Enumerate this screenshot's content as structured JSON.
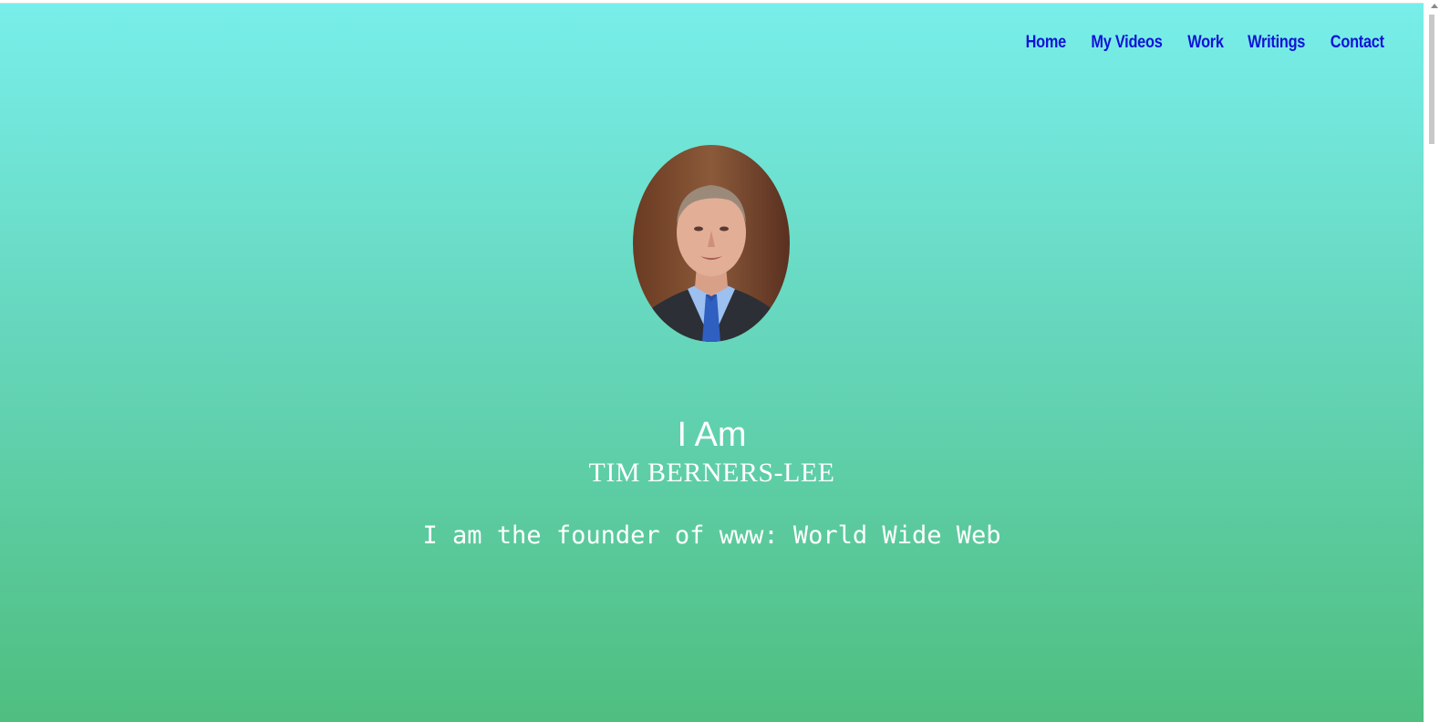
{
  "nav": {
    "items": [
      {
        "label": "Home"
      },
      {
        "label": "My Videos"
      },
      {
        "label": "Work"
      },
      {
        "label": "Writings"
      },
      {
        "label": "Contact"
      }
    ]
  },
  "hero": {
    "greeting": "I Am",
    "name": "TIM BERNERS-LEE",
    "tagline": "I am the founder of www: World Wide Web",
    "portrait_icon": "person-portrait"
  },
  "colors": {
    "gradient_top": "#78eeea",
    "gradient_bottom": "#4fbe7f",
    "nav_link": "#1212d9",
    "text": "#ffffff"
  }
}
